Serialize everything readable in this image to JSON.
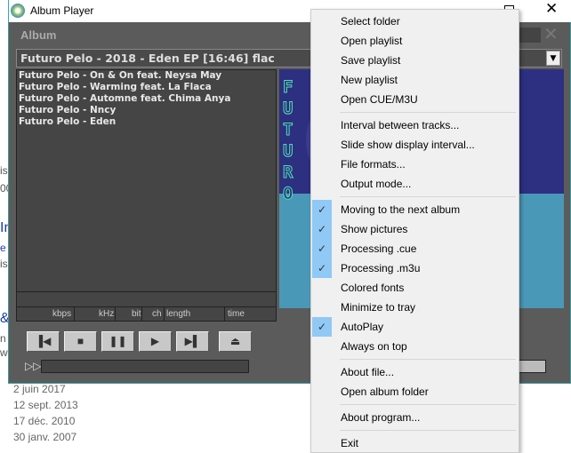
{
  "window": {
    "title": "Album Player",
    "maximize_icon": "maximize-icon",
    "close_icon": "close-icon"
  },
  "background": {
    "fragments": [
      "is",
      "00",
      "In",
      "e",
      "is",
      "&",
      "n",
      "w"
    ],
    "dates": [
      "2 juin 2017",
      "12 sept. 2013",
      "17 déc. 2010",
      "30 janv. 2007"
    ]
  },
  "player": {
    "section_label": "Album",
    "album_combo": "Futuro Pelo - 2018 - Eden EP  [16:46]  flac",
    "tracks": [
      "Futuro Pelo - On & On feat. Neysa May",
      "Futuro Pelo - Warming feat. La Flaca",
      "Futuro Pelo - Automne feat. Chima Anya",
      "Futuro Pelo - Nncy",
      "Futuro Pelo - Eden"
    ],
    "info_columns": [
      "kbps",
      "kHz",
      "bit",
      "ch",
      "length",
      "time"
    ],
    "cover_text": "FUTURO",
    "buttons": [
      "previous",
      "stop",
      "pause",
      "play",
      "next",
      "eject"
    ]
  },
  "menu": {
    "groups": [
      [
        {
          "label": "Select folder"
        },
        {
          "label": "Open playlist"
        },
        {
          "label": "Save playlist"
        },
        {
          "label": "New playlist"
        },
        {
          "label": "Open CUE/M3U"
        }
      ],
      [
        {
          "label": "Interval between tracks..."
        },
        {
          "label": "Slide show display interval..."
        },
        {
          "label": "File formats..."
        },
        {
          "label": "Output mode..."
        }
      ],
      [
        {
          "label": "Moving to the next album",
          "checked": true
        },
        {
          "label": "Show pictures",
          "checked": true
        },
        {
          "label": "Processing .cue",
          "checked": true
        },
        {
          "label": "Processing .m3u",
          "checked": true
        },
        {
          "label": "Colored fonts",
          "checked": false
        },
        {
          "label": "Minimize to tray",
          "checked": false
        },
        {
          "label": "AutoPlay",
          "checked": true
        },
        {
          "label": "Always on top",
          "checked": false
        }
      ],
      [
        {
          "label": "About file..."
        },
        {
          "label": "Open album folder"
        }
      ],
      [
        {
          "label": "About program..."
        }
      ],
      [
        {
          "label": "Exit"
        }
      ]
    ],
    "check_color": "#90c8f6"
  }
}
